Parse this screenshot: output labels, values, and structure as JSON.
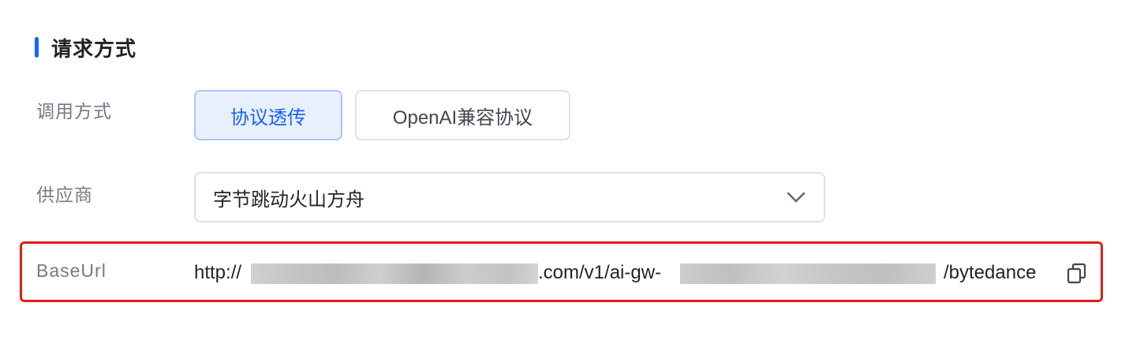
{
  "section": {
    "title": "请求方式"
  },
  "invoke": {
    "label": "调用方式",
    "options": [
      "协议透传",
      "OpenAI兼容协议"
    ],
    "selected_index": 0
  },
  "provider": {
    "label": "供应商",
    "value": "字节跳动火山方舟"
  },
  "base_url": {
    "label": "BaseUrl",
    "prefix": "http://",
    "middle": ".com/v1/ai-gw-",
    "suffix": "/bytedance"
  },
  "colors": {
    "accent": "#1664ff",
    "highlight_border": "#e11c1c",
    "active_bg": "#e8f0ff"
  },
  "icons": {
    "select_arrow": "chevron-down-icon",
    "copy": "copy-icon"
  }
}
